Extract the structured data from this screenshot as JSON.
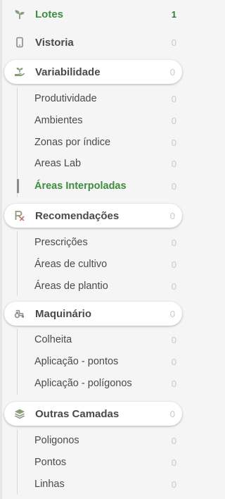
{
  "menu": {
    "lotes": {
      "label": "Lotes",
      "count": "1",
      "icon": "sprout-icon"
    },
    "vistoria": {
      "label": "Vistoria",
      "count": "0",
      "icon": "phone-icon"
    },
    "variabilidade": {
      "label": "Variabilidade",
      "count": "0",
      "icon": "hand-plant-icon",
      "items": [
        {
          "label": "Produtividade",
          "count": "0"
        },
        {
          "label": "Ambientes",
          "count": "0"
        },
        {
          "label": "Zonas por índice",
          "count": "0"
        },
        {
          "label": "Areas Lab",
          "count": "0"
        },
        {
          "label": "Áreas Interpoladas",
          "count": "0"
        }
      ]
    },
    "recomendacoes": {
      "label": "Recomendações",
      "count": "0",
      "icon": "prescription-icon",
      "items": [
        {
          "label": "Prescrições",
          "count": "0"
        },
        {
          "label": "Áreas de cultivo",
          "count": "0"
        },
        {
          "label": "Áreas de plantio",
          "count": "0"
        }
      ]
    },
    "maquinario": {
      "label": "Maquinário",
      "count": "0",
      "icon": "tractor-icon",
      "items": [
        {
          "label": "Colheita",
          "count": "0"
        },
        {
          "label": "Aplicação - pontos",
          "count": "0"
        },
        {
          "label": "Aplicação - polígonos",
          "count": "0"
        }
      ]
    },
    "outras": {
      "label": "Outras Camadas",
      "count": "0",
      "icon": "layers-icon",
      "items": [
        {
          "label": "Poligonos",
          "count": "0"
        },
        {
          "label": "Pontos",
          "count": "0"
        },
        {
          "label": "Linhas",
          "count": "0"
        }
      ]
    }
  },
  "colors": {
    "accent": "#3d8c40",
    "count_active": "#2e7d32",
    "count_muted": "#c8c8c8"
  }
}
